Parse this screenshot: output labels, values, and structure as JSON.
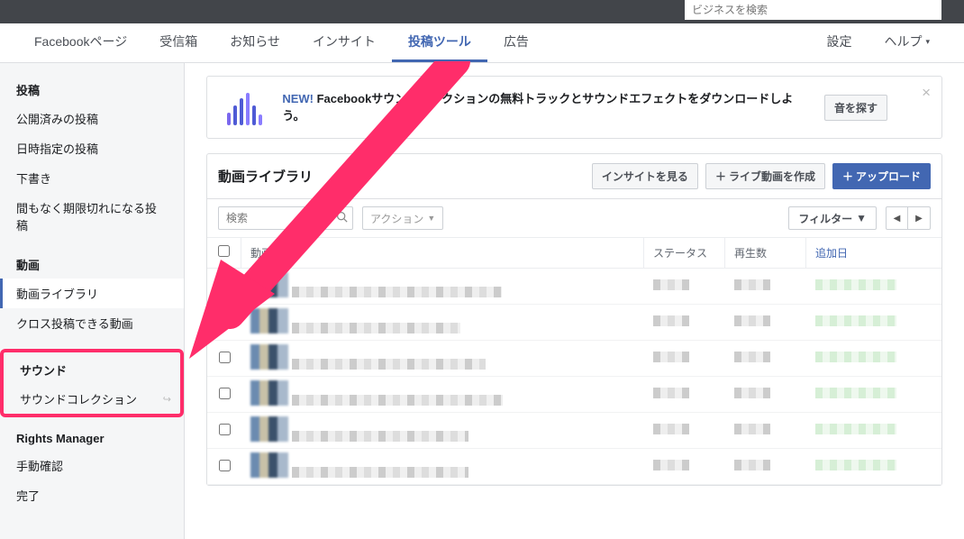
{
  "topbar": {
    "search_placeholder": "ビジネスを検索"
  },
  "tabs": {
    "left": [
      "Facebookページ",
      "受信箱",
      "お知らせ",
      "インサイト",
      "投稿ツール",
      "広告"
    ],
    "active_index": 4,
    "right": [
      "設定",
      "ヘルプ"
    ]
  },
  "sidebar": {
    "groups": [
      {
        "title": "投稿",
        "items": [
          "公開済みの投稿",
          "日時指定の投稿",
          "下書き",
          "間もなく期限切れになる投稿"
        ],
        "active": -1
      },
      {
        "title": "動画",
        "items": [
          "動画ライブラリ",
          "クロス投稿できる動画"
        ],
        "active": 0
      },
      {
        "title": "サウンド",
        "items": [
          "サウンドコレクション"
        ],
        "active": -1,
        "highlight": true,
        "popout": true
      },
      {
        "title": "Rights Manager",
        "items": [
          "手動確認",
          "完了"
        ],
        "active": -1
      }
    ]
  },
  "notice": {
    "new_label": "NEW!",
    "bold_text": "Facebookサウンドコレクションの無料トラックとサウンドエフェクトをダウンロードしよう。",
    "button": "音を探す"
  },
  "panel": {
    "title": "動画ライブラリ",
    "buttons": {
      "insight": "インサイトを見る",
      "live": "ライブ動画を作成",
      "upload": "アップロード"
    },
    "search_placeholder": "検索",
    "action_label": "アクション",
    "filter_label": "フィルター",
    "columns": {
      "video": "動画",
      "status": "ステータス",
      "plays": "再生数",
      "date": "追加日"
    },
    "row_count": 6
  }
}
